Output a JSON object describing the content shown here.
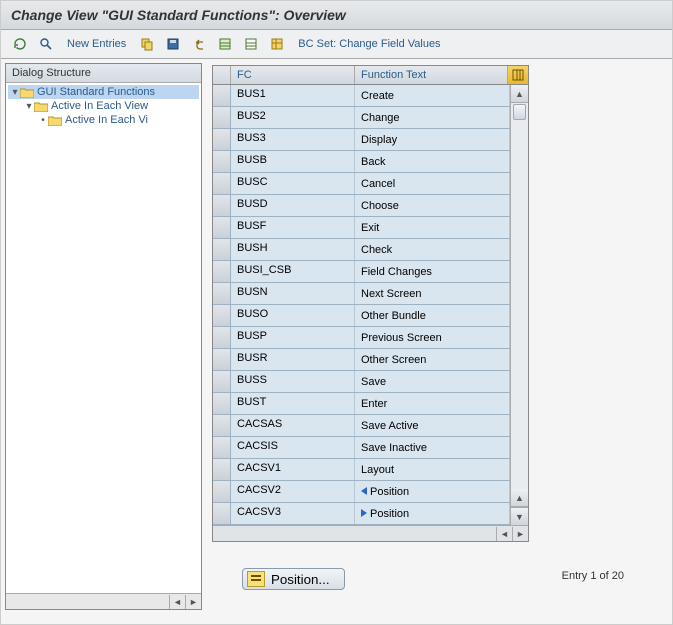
{
  "title": "Change View \"GUI Standard Functions\": Overview",
  "toolbar": {
    "new_entries": "New Entries",
    "bc_set": "BC Set: Change Field Values"
  },
  "tree": {
    "header": "Dialog Structure",
    "nodes": [
      {
        "label": "GUI Standard Functions",
        "level": 0,
        "open": true,
        "selected": true
      },
      {
        "label": "Active In Each View",
        "level": 1,
        "open": true,
        "selected": false
      },
      {
        "label": "Active In Each Vi",
        "level": 2,
        "open": false,
        "selected": false
      }
    ]
  },
  "grid": {
    "col_fc": "FC",
    "col_ft": "Function Text",
    "rows": [
      {
        "fc": "BUS1",
        "ft": "Create",
        "icon": ""
      },
      {
        "fc": "BUS2",
        "ft": "Change",
        "icon": ""
      },
      {
        "fc": "BUS3",
        "ft": "Display",
        "icon": ""
      },
      {
        "fc": "BUSB",
        "ft": "Back",
        "icon": ""
      },
      {
        "fc": "BUSC",
        "ft": "Cancel",
        "icon": ""
      },
      {
        "fc": "BUSD",
        "ft": "Choose",
        "icon": ""
      },
      {
        "fc": "BUSF",
        "ft": "Exit",
        "icon": ""
      },
      {
        "fc": "BUSH",
        "ft": "Check",
        "icon": ""
      },
      {
        "fc": "BUSI_CSB",
        "ft": "Field Changes",
        "icon": ""
      },
      {
        "fc": "BUSN",
        "ft": "Next Screen",
        "icon": ""
      },
      {
        "fc": "BUSO",
        "ft": "Other Bundle",
        "icon": ""
      },
      {
        "fc": "BUSP",
        "ft": "Previous Screen",
        "icon": ""
      },
      {
        "fc": "BUSR",
        "ft": "Other Screen",
        "icon": ""
      },
      {
        "fc": "BUSS",
        "ft": "Save",
        "icon": ""
      },
      {
        "fc": "BUST",
        "ft": "Enter",
        "icon": ""
      },
      {
        "fc": "CACSAS",
        "ft": "Save Active",
        "icon": ""
      },
      {
        "fc": "CACSIS",
        "ft": "Save Inactive",
        "icon": ""
      },
      {
        "fc": "CACSV1",
        "ft": "Layout",
        "icon": ""
      },
      {
        "fc": "CACSV2",
        "ft": "Position",
        "icon": "left"
      },
      {
        "fc": "CACSV3",
        "ft": "Position",
        "icon": "right"
      }
    ]
  },
  "position_btn": "Position...",
  "entry_text": "Entry 1 of 20"
}
